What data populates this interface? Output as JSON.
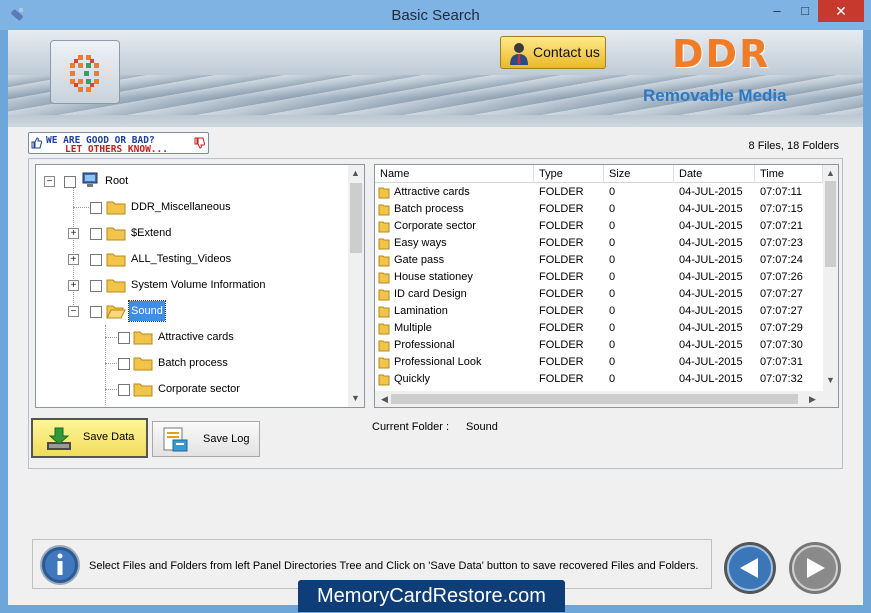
{
  "window": {
    "title": "Basic Search",
    "minimize": "–",
    "maximize": "□",
    "close": "✕"
  },
  "banner": {
    "contact_label": "Contact us",
    "brand": "DDR",
    "tagline": "Removable Media"
  },
  "feedback": {
    "line1": "WE ARE GOOD OR BAD?",
    "line2": "LET OTHERS KNOW..."
  },
  "summary": "8 Files, 18 Folders",
  "tree": {
    "root": "Root",
    "items": [
      {
        "label": "DDR_Miscellaneous",
        "expandable": false
      },
      {
        "label": "$Extend",
        "expandable": true
      },
      {
        "label": "ALL_Testing_Videos",
        "expandable": true
      },
      {
        "label": "System Volume Information",
        "expandable": true
      },
      {
        "label": "Sound",
        "expandable": true,
        "expanded": true,
        "selected": true
      },
      {
        "label": "Attractive cards",
        "child": true
      },
      {
        "label": "Batch process",
        "child": true
      },
      {
        "label": "Corporate sector",
        "child": true
      }
    ]
  },
  "list": {
    "columns": [
      "Name",
      "Type",
      "Size",
      "Date",
      "Time"
    ],
    "rows": [
      [
        "Attractive cards",
        "FOLDER",
        "0",
        "04-JUL-2015",
        "07:07:11"
      ],
      [
        "Batch process",
        "FOLDER",
        "0",
        "04-JUL-2015",
        "07:07:15"
      ],
      [
        "Corporate sector",
        "FOLDER",
        "0",
        "04-JUL-2015",
        "07:07:21"
      ],
      [
        "Easy ways",
        "FOLDER",
        "0",
        "04-JUL-2015",
        "07:07:23"
      ],
      [
        "Gate pass",
        "FOLDER",
        "0",
        "04-JUL-2015",
        "07:07:24"
      ],
      [
        "House stationey",
        "FOLDER",
        "0",
        "04-JUL-2015",
        "07:07:26"
      ],
      [
        "ID card Design",
        "FOLDER",
        "0",
        "04-JUL-2015",
        "07:07:27"
      ],
      [
        "Lamination",
        "FOLDER",
        "0",
        "04-JUL-2015",
        "07:07:27"
      ],
      [
        "Multiple",
        "FOLDER",
        "0",
        "04-JUL-2015",
        "07:07:29"
      ],
      [
        "Professional",
        "FOLDER",
        "0",
        "04-JUL-2015",
        "07:07:30"
      ],
      [
        "Professional Look",
        "FOLDER",
        "0",
        "04-JUL-2015",
        "07:07:31"
      ],
      [
        "Quickly",
        "FOLDER",
        "0",
        "04-JUL-2015",
        "07:07:32"
      ]
    ]
  },
  "buttons": {
    "save_data": "Save Data",
    "save_log": "Save Log"
  },
  "current_folder": {
    "label": "Current Folder :",
    "value": "Sound"
  },
  "status": {
    "message": "Select Files and Folders from left Panel Directories Tree and Click on 'Save Data' button to save recovered Files and Folders."
  },
  "footer": {
    "site": "MemoryCardRestore.com"
  },
  "colors": {
    "selection": "#3d8ee6",
    "save_button": "#f0dd5a",
    "brand_orange": "#f07c28",
    "tagline_blue": "#2a78c8",
    "footer_bg": "#0e3d78"
  }
}
